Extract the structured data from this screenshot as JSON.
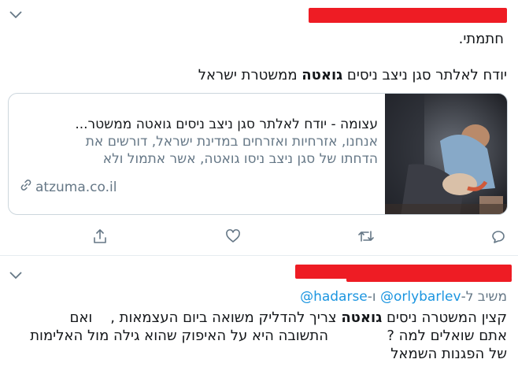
{
  "tweet1": {
    "line1": "חתמתי.",
    "line2_pre": "יודח לאלתר סגן ניצב ניסים ",
    "line2_bold": "גואטה",
    "line2_post": " ממשטרת ישראל",
    "card": {
      "title": "עצומה - יודח לאלתר סגן ניצב ניסים גואטה ממשטר...",
      "desc_line1": "אנחנו, אזרחיות ואזרחים במדינת ישראל, דורשים את",
      "desc_line2": "הדחתו של סגן ניצב ניסו גואטה, אשר אתמול ולא",
      "link": "atzuma.co.il"
    }
  },
  "tweet2": {
    "replying_label": "משיב ל-",
    "mention1": "@orlybarlev",
    "connector": " ו-",
    "mention2": "@hadarse",
    "l1_pre": "קצין המשטרה ניסים ",
    "l1_bold": "גואטה",
    "l1_post": " צריך להדליק משואה ביום העצמאות ,    ואם",
    "l2": "אתם שואלים למה ?             התשובה היא על האיפוק שהוא גילה מול האלימות",
    "l3": "של הפגנות השמאל"
  },
  "icons": {
    "caret": "chevron-down-icon",
    "link": "link-icon",
    "share": "share-icon",
    "like": "heart-icon",
    "retweet": "retweet-icon",
    "reply": "reply-icon"
  },
  "colors": {
    "redaction": "#ee1c24",
    "link": "#1b95e0",
    "muted": "#657786"
  }
}
